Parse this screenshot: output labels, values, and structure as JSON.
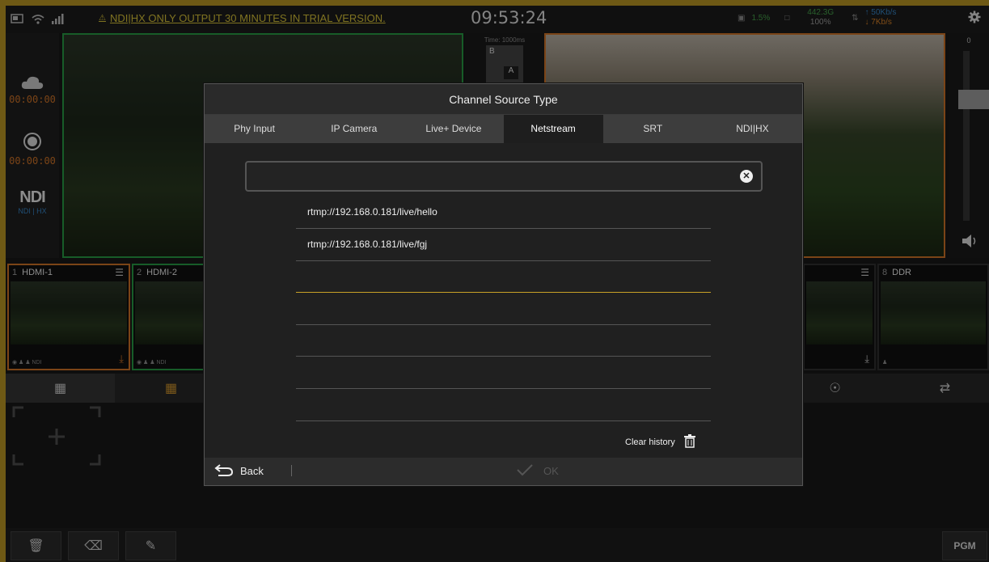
{
  "topbar": {
    "warning": "NDI|HX ONLY OUTPUT 30 MINUTES IN TRIAL VERSION.",
    "clock": "09:53:24",
    "cpu": "1.5%",
    "storage": "442.3G",
    "storage_pct": "100%",
    "upload": "50Kb/s",
    "download": "7Kb/s"
  },
  "left_panel": {
    "stream_time": "00:00:00",
    "record_time": "00:00:00",
    "ndi_logo": "NDI",
    "ndi_sub": "NDI | HX"
  },
  "transition": {
    "time": "Time: 1000ms",
    "b": "B",
    "a": "A"
  },
  "audio": {
    "top_label": "0"
  },
  "thumbs": [
    {
      "num": "1",
      "name": "HDMI-1",
      "foot": "NDI"
    },
    {
      "num": "2",
      "name": "HDMI-2",
      "foot": "NDI"
    },
    {
      "num": "8",
      "name": "DDR",
      "foot": ""
    }
  ],
  "bottom": {
    "pgm": "PGM"
  },
  "dialog": {
    "title": "Channel Source Type",
    "tabs": [
      "Phy Input",
      "IP Camera",
      "Live+ Device",
      "Netstream",
      "SRT",
      "NDI|HX"
    ],
    "url_value": "",
    "history": [
      "rtmp://192.168.0.181/live/hello",
      "rtmp://192.168.0.181/live/fgj",
      "",
      "",
      "",
      "",
      ""
    ],
    "clear_history": "Clear history",
    "back": "Back",
    "ok": "OK"
  },
  "colors": {
    "accent": "#c9a227",
    "preview_border": "#2aa84a",
    "program_border": "#e07c2a",
    "ndi_blue": "#3a8fd6"
  }
}
